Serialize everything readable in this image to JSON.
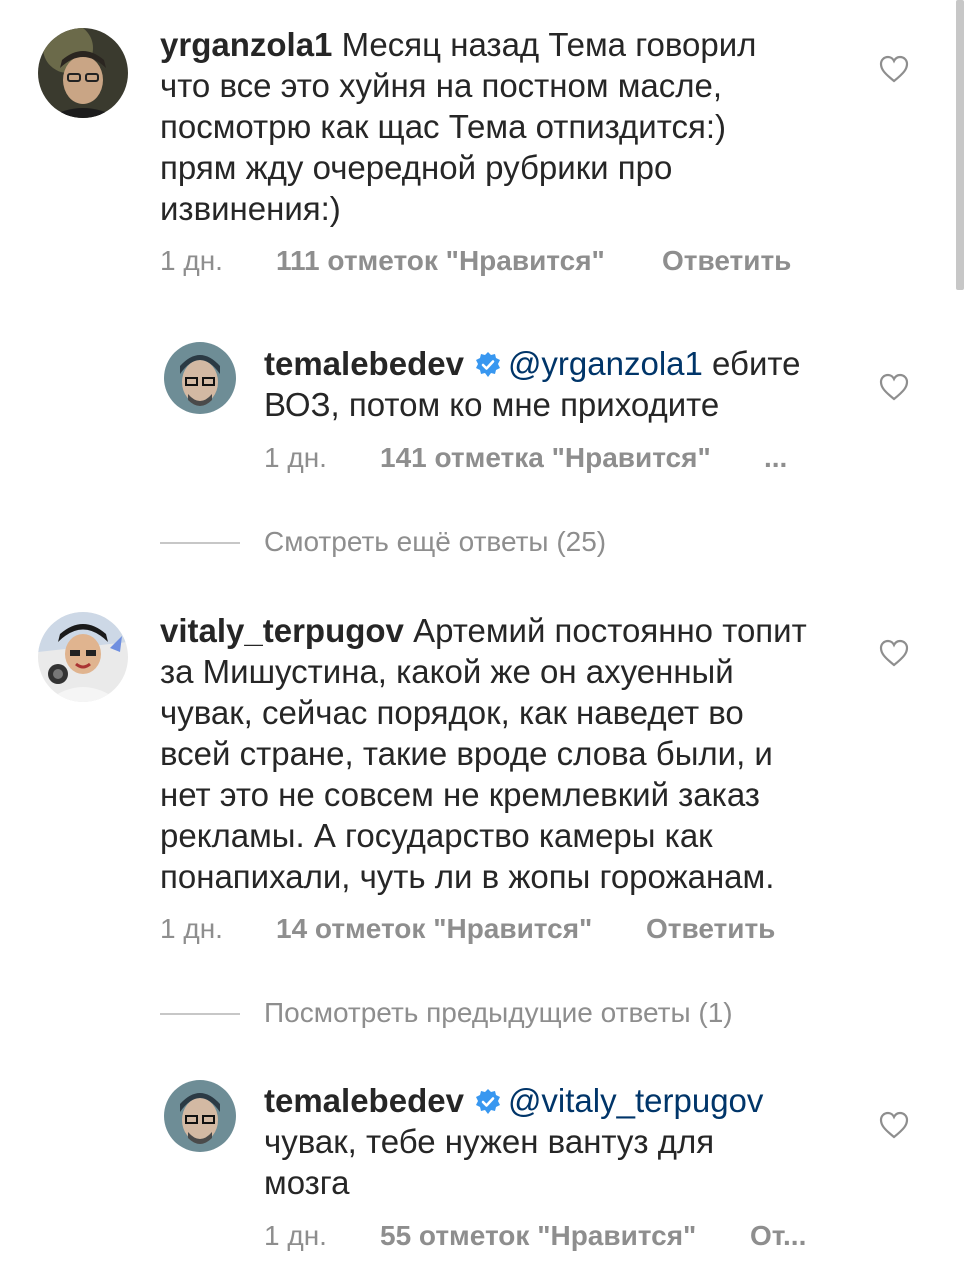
{
  "comments": [
    {
      "username": "yrganzola1",
      "text_lines": [
        " Месяц назад Тема говорил",
        "что все это хуйня на постном масле,",
        "посмотрю как щас Тема отпиздится:)",
        "прям жду очередной рубрики про",
        "извинения:)"
      ],
      "time": "1 дн.",
      "likes": "111 отметок \"Нравится\"",
      "reply": "Ответить"
    },
    {
      "username": "temalebedev",
      "verified": true,
      "mention": "@yrganzola1",
      "text_first_rest": " ебите",
      "text_lines": [
        "ВОЗ, потом ко мне приходите"
      ],
      "time": "1 дн.",
      "likes": "141 отметка \"Нравится\"",
      "reply": "..."
    },
    {
      "username": "vitaly_terpugov",
      "text_lines": [
        " Артемий постоянно топит",
        "за Мишустина, какой же он ахуенный",
        "чувак, сейчас порядок, как наведет во",
        "всей стране, такие вроде слова были, и",
        "нет это не совсем не кремлевкий заказ",
        "рекламы. А государство камеры как",
        "понапихали, чуть ли в жопы горожанам."
      ],
      "time": "1 дн.",
      "likes": "14 отметок \"Нравится\"",
      "reply": "Ответить"
    },
    {
      "username": "temalebedev",
      "verified": true,
      "mention": "@vitaly_terpugov",
      "text_lines": [
        "чувак, тебе нужен вантуз для",
        "мозга"
      ],
      "time": "1 дн.",
      "likes": "55 отметок \"Нравится\"",
      "reply": "От..."
    }
  ],
  "view_more_replies": "Смотреть ещё ответы (25)",
  "view_previous_replies": "Посмотреть предыдущие ответы (1)",
  "colors": {
    "text": "#262626",
    "meta": "#8e8e8e",
    "mention": "#003569",
    "verified": "#3897f0"
  },
  "icons": [
    "heart-icon",
    "verified-badge-icon"
  ]
}
